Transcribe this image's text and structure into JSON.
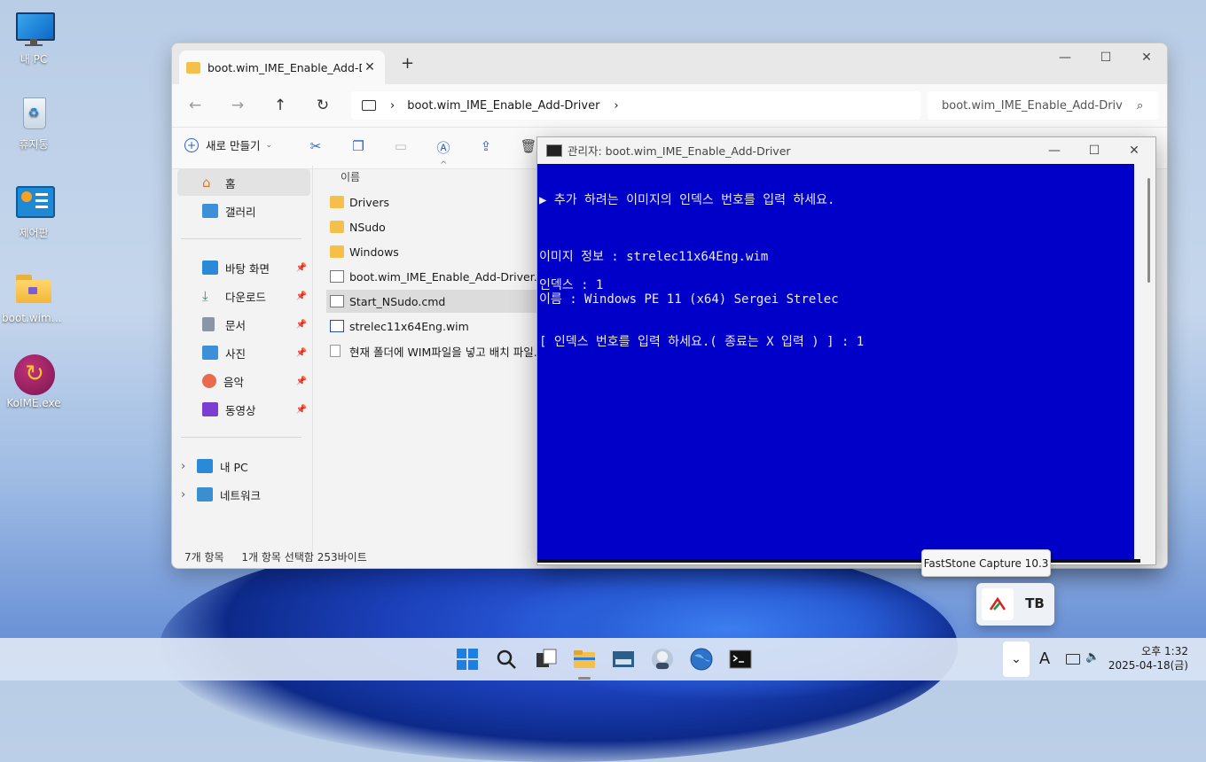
{
  "desktop": {
    "icons": [
      {
        "label": "내 PC",
        "icon": "monitor-icon"
      },
      {
        "label": "휴지통",
        "icon": "recycle-bin-icon"
      },
      {
        "label": "제어판",
        "icon": "control-panel-icon"
      },
      {
        "label": "boot.wim_I...",
        "icon": "folder-icon"
      },
      {
        "label": "KoIME.exe",
        "icon": "koime-app-icon"
      }
    ]
  },
  "explorer": {
    "tab_title": "boot.wim_IME_Enable_Add-D",
    "close_tab": "✕",
    "new_tab": "+",
    "window_controls": {
      "minimize": "—",
      "maximize": "☐",
      "close": "✕"
    },
    "nav": {
      "back": "←",
      "forward": "→",
      "up": "↑",
      "refresh": "↻"
    },
    "address_path": "boot.wim_IME_Enable_Add-Driver",
    "search_text": "boot.wim_IME_Enable_Add-Driv",
    "new_button": "새로 만들기",
    "sidebar": {
      "home": "홈",
      "gallery": "갤러리",
      "pinned": [
        {
          "label": "바탕 화면",
          "icon": "desktop-icon"
        },
        {
          "label": "다운로드",
          "icon": "download-icon"
        },
        {
          "label": "문서",
          "icon": "document-icon"
        },
        {
          "label": "사진",
          "icon": "pictures-icon"
        },
        {
          "label": "음악",
          "icon": "music-icon"
        },
        {
          "label": "동영상",
          "icon": "videos-icon"
        }
      ],
      "this_pc": "내 PC",
      "network": "네트워크"
    },
    "column_name": "이름",
    "files": [
      {
        "name": "Drivers",
        "type": "folder"
      },
      {
        "name": "NSudo",
        "type": "folder"
      },
      {
        "name": "Windows",
        "type": "folder"
      },
      {
        "name": "boot.wim_IME_Enable_Add-Driver.cmd",
        "type": "cmd"
      },
      {
        "name": "Start_NSudo.cmd",
        "type": "cmd"
      },
      {
        "name": "strelec11x64Eng.wim",
        "type": "wim"
      },
      {
        "name": "현재 폴더에 WIM파일을 넣고 배치 파일...",
        "type": "txt"
      }
    ],
    "status_count": "7개 항목",
    "status_selection": "1개 항목 선택함 253바이트"
  },
  "console": {
    "title": "관리자:  boot.wim_IME_Enable_Add-Driver",
    "lines": [
      "▶ 추가 하려는 이미지의 인덱스 번호를 입력 하세요.",
      "이미지 정보 : strelec11x64Eng.wim",
      "인덱스 : 1",
      "이름 : Windows PE 11 (x64) Sergei Strelec",
      "[ 인덱스 번호를 입력 하세요.( 종료는 X 입력 ) ] : 1"
    ],
    "colors": {
      "background": "#0000c8",
      "text": "#e9e9f5"
    }
  },
  "tooltip": "FastStone Capture 10.3",
  "taskbar": {
    "apps": [
      "windows-start-icon",
      "search-icon",
      "task-view-icon",
      "file-explorer-icon",
      "keyboard-app-icon",
      "avatar-app-icon",
      "globe-icon",
      "terminal-icon"
    ],
    "ime_indicator": "A",
    "time": "오후 1:32",
    "date": "2025-04-18(금)"
  }
}
